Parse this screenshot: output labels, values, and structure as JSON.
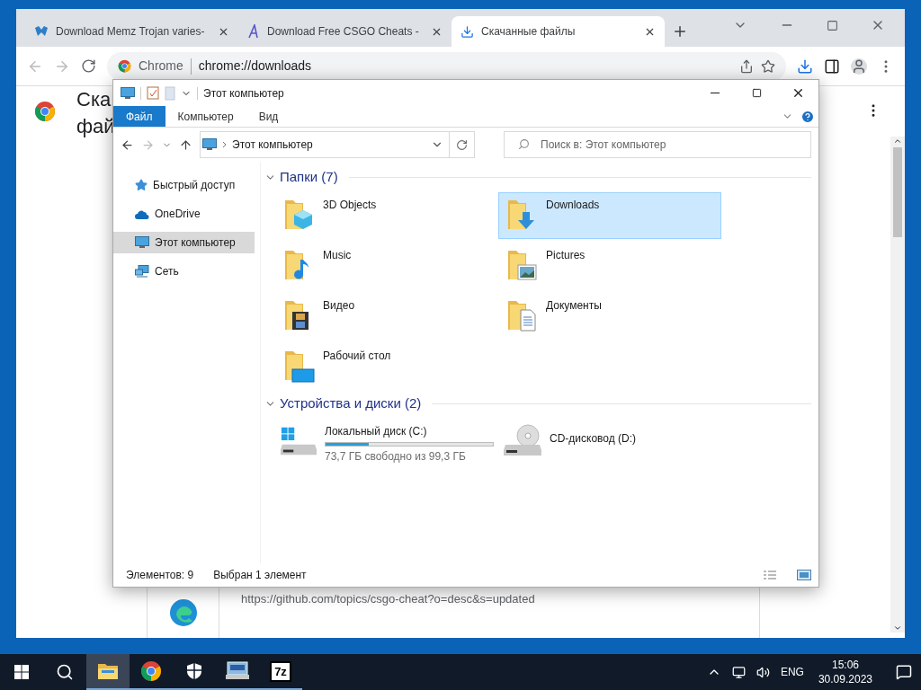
{
  "browser": {
    "tabs": [
      {
        "title": "Download Memz Trojan varies-",
        "selected": false
      },
      {
        "title": "Download Free CSGO Cheats -",
        "selected": false
      },
      {
        "title": "Скачанные файлы",
        "selected": true
      }
    ],
    "omnibox": {
      "site": "Chrome",
      "url": "chrome://downloads"
    },
    "heading_lines": [
      "Ска",
      "фай"
    ],
    "download_item": {
      "url": "https://github.com/topics/csgo-cheat?o=desc&s=updated"
    }
  },
  "explorer": {
    "title": "Этот компьютер",
    "ribbon_tabs": [
      {
        "label": "Файл",
        "selected": true
      },
      {
        "label": "Компьютер",
        "selected": false
      },
      {
        "label": "Вид",
        "selected": false
      }
    ],
    "address": "Этот компьютер",
    "search": {
      "placeholder": "Поиск в: Этот компьютер"
    },
    "nav": [
      {
        "label": "Быстрый доступ",
        "selected": false
      },
      {
        "label": "OneDrive",
        "selected": false
      },
      {
        "label": "Этот компьютер",
        "selected": true
      },
      {
        "label": "Сеть",
        "selected": false
      }
    ],
    "groups": [
      {
        "title": "Папки (7)",
        "expanded": true,
        "items": [
          {
            "kind": "folder",
            "name": "3D Objects",
            "selected": false
          },
          {
            "kind": "folder",
            "name": "Downloads",
            "selected": true
          },
          {
            "kind": "folder",
            "name": "Music",
            "selected": false
          },
          {
            "kind": "folder",
            "name": "Pictures",
            "selected": false
          },
          {
            "kind": "folder",
            "name": "Видео",
            "selected": false
          },
          {
            "kind": "folder",
            "name": "Документы",
            "selected": false
          },
          {
            "kind": "folder",
            "name": "Рабочий стол",
            "selected": false
          }
        ]
      },
      {
        "title": "Устройства и диски (2)",
        "expanded": true,
        "items": [
          {
            "kind": "disk",
            "name": "Локальный диск (C:)",
            "level": 0.26,
            "free": "73,7 ГБ свободно из 99,3 ГБ",
            "selected": false
          },
          {
            "kind": "cdrom",
            "name": "CD-дисковод (D:)",
            "selected": false
          }
        ]
      }
    ],
    "status": {
      "count": "Элементов: 9",
      "selection": "Выбран 1 элемент"
    }
  },
  "taskbar": {
    "apps": [
      {
        "active": true
      },
      {
        "active": false
      },
      {
        "active": false
      },
      {
        "active": false
      },
      {
        "label": "7z",
        "active": false
      }
    ],
    "language": "ENG",
    "time": "15:06",
    "date": "30.09.2023"
  }
}
